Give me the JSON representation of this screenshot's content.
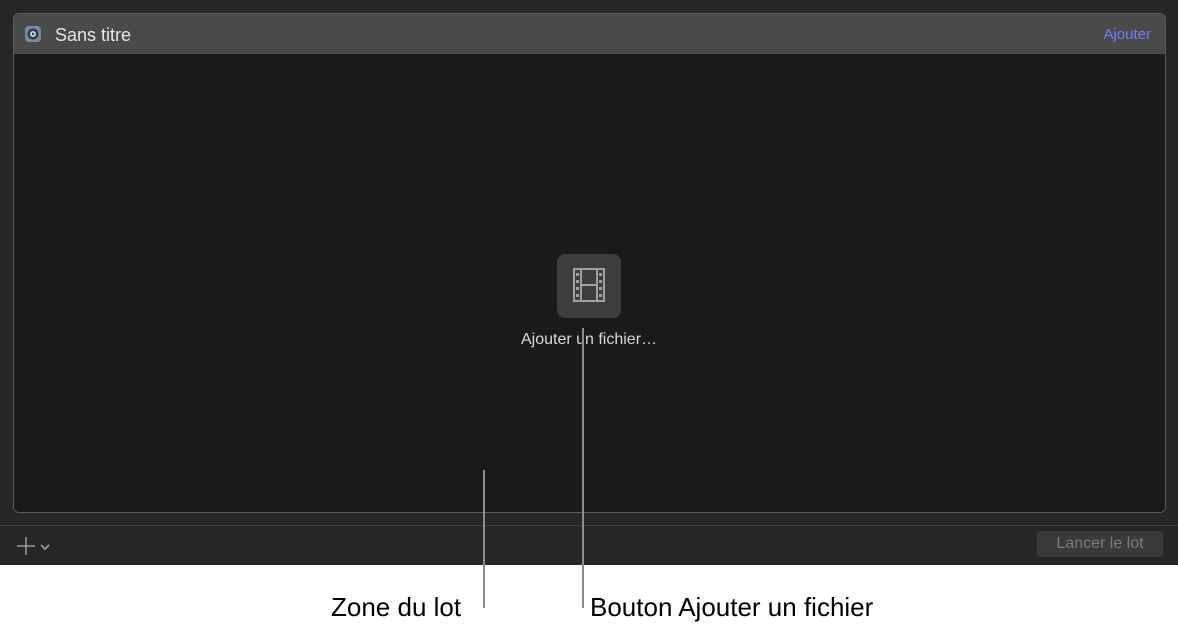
{
  "batch": {
    "title": "Sans titre",
    "add_link": "Ajouter"
  },
  "drop_zone": {
    "add_file_label": "Ajouter un fichier…",
    "icon": "film-icon"
  },
  "bottom_bar": {
    "add_menu_icon": "plus-chevron-icon",
    "run_button": "Lancer le lot"
  },
  "callouts": {
    "zone": "Zone du lot",
    "add_file_button": "Bouton Ajouter un fichier"
  },
  "colors": {
    "accent": "#7b79ff",
    "background": "#262626",
    "panel": "#1a1a1a",
    "header": "#4a4a4a"
  }
}
